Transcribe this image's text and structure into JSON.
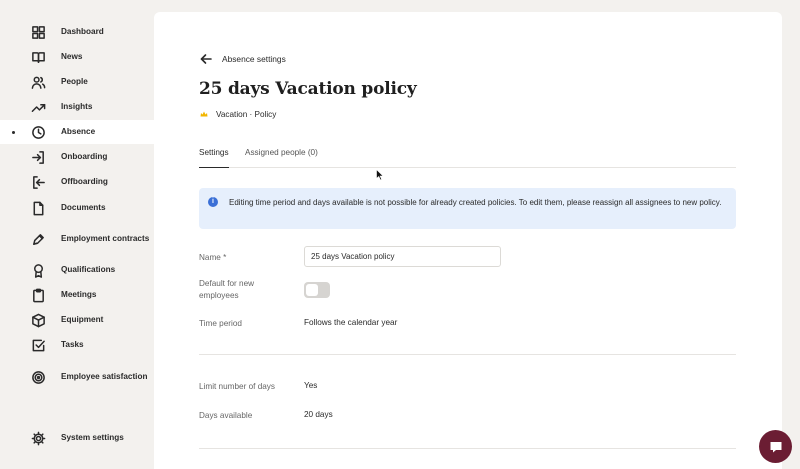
{
  "sidebar": {
    "items": [
      {
        "label": "Dashboard",
        "icon": "grid-icon"
      },
      {
        "label": "News",
        "icon": "book-icon"
      },
      {
        "label": "People",
        "icon": "people-icon"
      },
      {
        "label": "Insights",
        "icon": "trend-icon"
      },
      {
        "label": "Absence",
        "icon": "clock-icon",
        "active": true
      },
      {
        "label": "Onboarding",
        "icon": "login-icon"
      },
      {
        "label": "Offboarding",
        "icon": "logout-icon"
      },
      {
        "label": "Documents",
        "icon": "document-icon"
      },
      {
        "label": "Employment contracts",
        "icon": "pen-icon"
      },
      {
        "label": "Qualifications",
        "icon": "award-icon"
      },
      {
        "label": "Meetings",
        "icon": "clipboard-icon"
      },
      {
        "label": "Equipment",
        "icon": "box-icon"
      },
      {
        "label": "Tasks",
        "icon": "checkbox-icon"
      },
      {
        "label": "Employee satisfaction",
        "icon": "target-icon"
      }
    ],
    "system_settings": "System settings"
  },
  "header": {
    "back_label": "Absence settings",
    "title": "25 days Vacation policy",
    "subtitle": "Vacation · Policy",
    "emoji_color": "#f2b600"
  },
  "tabs": [
    {
      "label": "Settings",
      "active": true
    },
    {
      "label": "Assigned people (0)",
      "active": false
    }
  ],
  "info_banner": {
    "text": "Editing time period and days available is not possible for already created policies. To edit them, please reassign all assignees to new policy."
  },
  "form": {
    "name_label": "Name *",
    "name_value": "25 days Vacation policy",
    "default_label": "Default for new employees",
    "default_on": false,
    "time_period_label": "Time period",
    "time_period_value": "Follows the calendar year",
    "limit_label": "Limit number of days",
    "limit_value": "Yes",
    "days_label": "Days available",
    "days_value": "20 days"
  },
  "colors": {
    "accent": "#6b1d33",
    "info_bg": "#e6effc",
    "info_icon": "#3a6fd6"
  }
}
